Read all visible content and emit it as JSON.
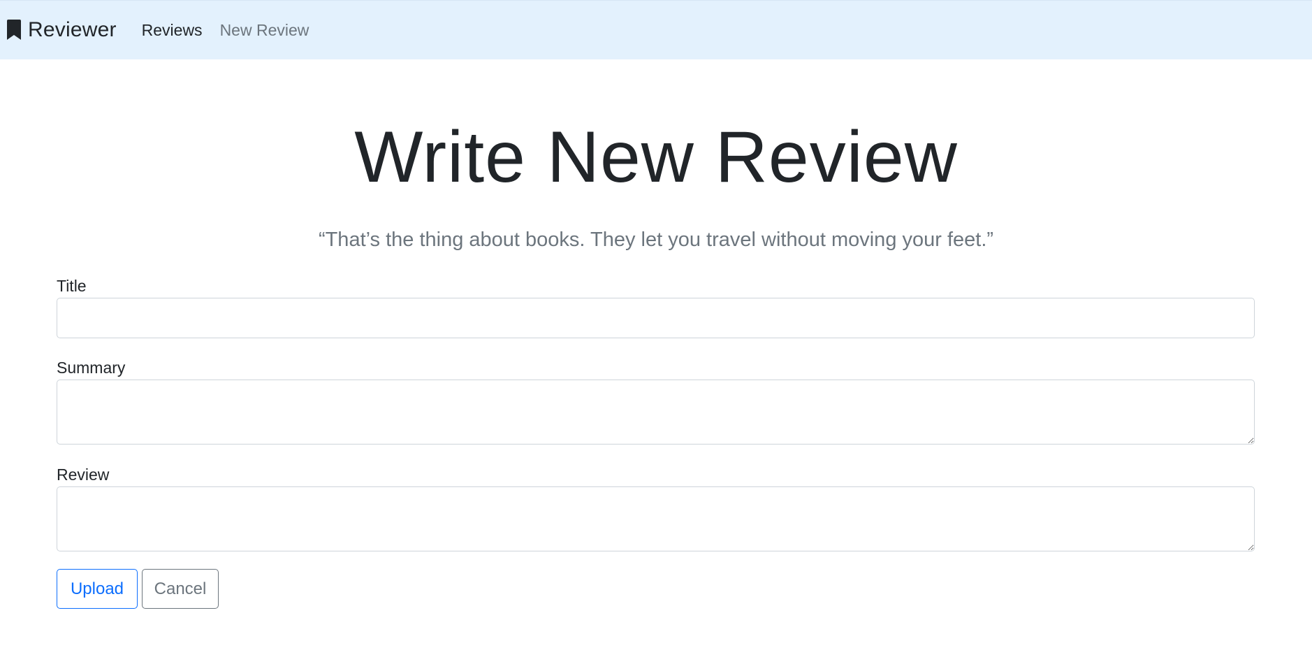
{
  "navbar": {
    "brand": "Reviewer",
    "brand_icon": "bookmark-icon",
    "links": [
      {
        "label": "Reviews"
      },
      {
        "label": "New Review"
      }
    ],
    "background": "#e3f1fd"
  },
  "main": {
    "title": "Write New Review",
    "quote": "“That’s the thing about books. They let you travel without moving your feet.”"
  },
  "form": {
    "title": {
      "label": "Title",
      "value": ""
    },
    "summary": {
      "label": "Summary",
      "value": ""
    },
    "review": {
      "label": "Review",
      "value": ""
    },
    "upload_label": "Upload",
    "cancel_label": "Cancel"
  },
  "colors": {
    "primary": "#0d6efd",
    "secondary": "#6c757d",
    "text": "#212529"
  }
}
